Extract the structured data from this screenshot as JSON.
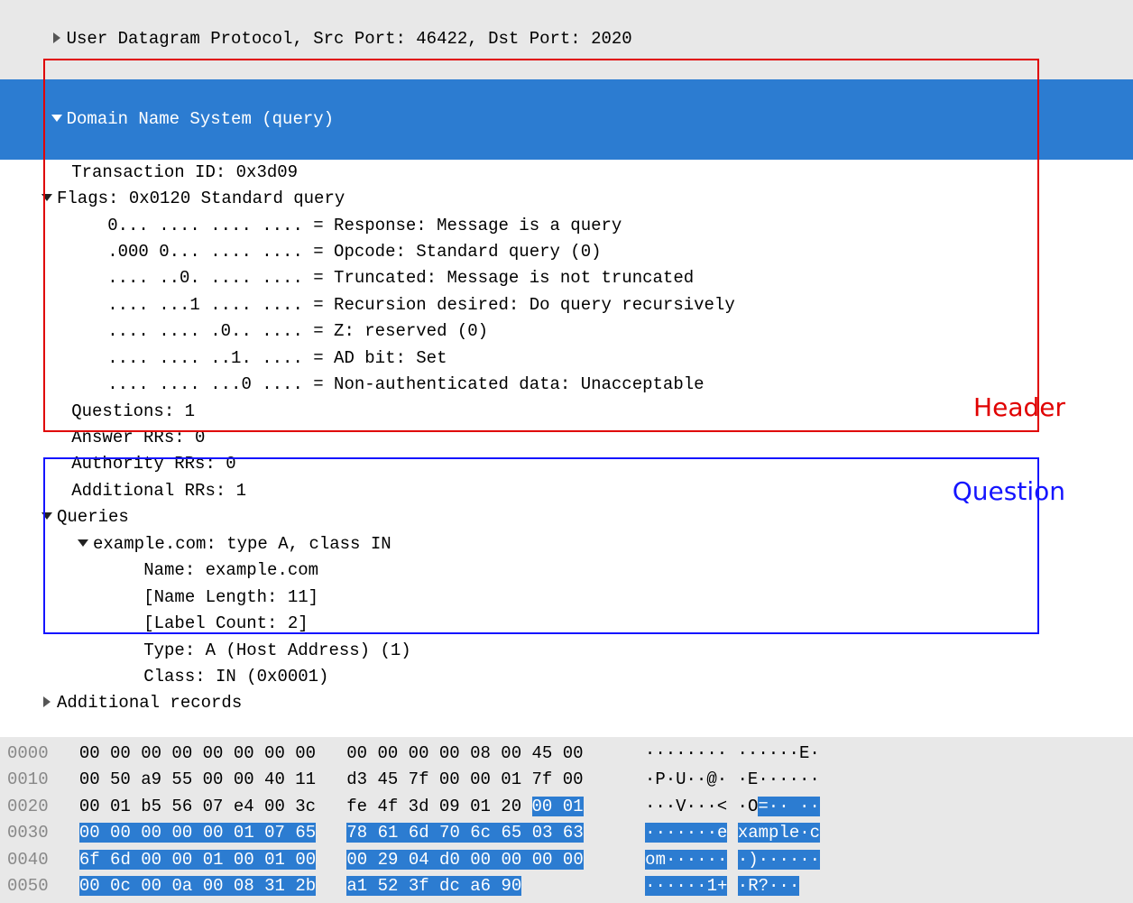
{
  "tree": {
    "udp_line": "User Datagram Protocol, Src Port: 46422, Dst Port: 2020",
    "dns_line": "Domain Name System (query)",
    "txn_id": "Transaction ID: 0x3d09",
    "flags_line": "Flags: 0x0120 Standard query",
    "flags": [
      "0... .... .... .... = Response: Message is a query",
      ".000 0... .... .... = Opcode: Standard query (0)",
      ".... ..0. .... .... = Truncated: Message is not truncated",
      ".... ...1 .... .... = Recursion desired: Do query recursively",
      ".... .... .0.. .... = Z: reserved (0)",
      ".... .... ..1. .... = AD bit: Set",
      ".... .... ...0 .... = Non-authenticated data: Unacceptable"
    ],
    "questions": "Questions: 1",
    "answer_rrs": "Answer RRs: 0",
    "authority_rrs": "Authority RRs: 0",
    "additional_rrs": "Additional RRs: 1",
    "queries_label": "Queries",
    "query_summary": "example.com: type A, class IN",
    "query_fields": [
      "Name: example.com",
      "[Name Length: 11]",
      "[Label Count: 2]",
      "Type: A (Host Address) (1)",
      "Class: IN (0x0001)"
    ],
    "additional_records": "Additional records"
  },
  "annotations": {
    "header_label": "Header",
    "question_label": "Question"
  },
  "hex": {
    "rows": [
      {
        "offset": "0000",
        "a": "00 00 00 00 00 00 00 00",
        "b": "00 00 00 00 08 00 45 00",
        "ca": "········",
        "cb": "······E·",
        "sel_a_from": -1,
        "sel_b_from": -1,
        "sel_ca_from": -1,
        "sel_cb_from": -1
      },
      {
        "offset": "0010",
        "a": "00 50 a9 55 00 00 40 11",
        "b": "d3 45 7f 00 00 01 7f 00",
        "ca": "·P·U··@·",
        "cb": "·E······",
        "sel_a_from": -1,
        "sel_b_from": -1,
        "sel_ca_from": -1,
        "sel_cb_from": -1
      },
      {
        "offset": "0020",
        "a": "00 01 b5 56 07 e4 00 3c",
        "b": "fe 4f 3d 09 01 20 00 01",
        "ca": "···V···<",
        "cb": "·O=·· ··",
        "sel_a_from": -1,
        "sel_b_from": 6,
        "sel_ca_from": -1,
        "sel_cb_from": 2
      },
      {
        "offset": "0030",
        "a": "00 00 00 00 00 01 07 65",
        "b": "78 61 6d 70 6c 65 03 63",
        "ca": "·······e",
        "cb": "xample·c",
        "sel_a_from": 0,
        "sel_b_from": 0,
        "sel_ca_from": 0,
        "sel_cb_from": 0
      },
      {
        "offset": "0040",
        "a": "6f 6d 00 00 01 00 01 00",
        "b": "00 29 04 d0 00 00 00 00",
        "ca": "om······",
        "cb": "·)······",
        "sel_a_from": 0,
        "sel_b_from": 0,
        "sel_ca_from": 0,
        "sel_cb_from": 0
      },
      {
        "offset": "0050",
        "a": "00 0c 00 0a 00 08 31 2b",
        "b": "a1 52 3f dc a6 90",
        "ca": "······1+",
        "cb": "·R?···",
        "sel_a_from": 0,
        "sel_b_from": 0,
        "sel_ca_from": 0,
        "sel_cb_from": 0
      }
    ]
  }
}
